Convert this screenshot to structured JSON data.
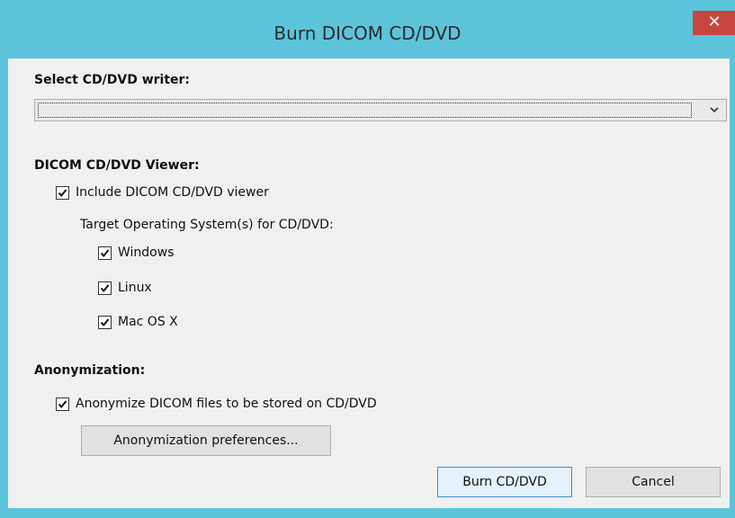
{
  "window": {
    "title": "Burn DICOM CD/DVD",
    "close_label": "✕"
  },
  "writer": {
    "section_label": "Select CD/DVD writer:",
    "selected_value": "",
    "arrow_icon": "chevron-down-icon"
  },
  "viewer": {
    "section_label": "DICOM CD/DVD Viewer:",
    "include_label": "Include DICOM CD/DVD viewer",
    "include_checked": true,
    "target_os_label": "Target Operating System(s) for CD/DVD:",
    "os_options": [
      {
        "label": "Windows",
        "checked": true
      },
      {
        "label": "Linux",
        "checked": true
      },
      {
        "label": "Mac OS X",
        "checked": true
      }
    ]
  },
  "anonymization": {
    "section_label": "Anonymization:",
    "anonymize_label": "Anonymize DICOM files to be stored on CD/DVD",
    "anonymize_checked": true,
    "preferences_button": "Anonymization preferences..."
  },
  "actions": {
    "burn_label": "Burn CD/DVD",
    "cancel_label": "Cancel"
  },
  "colors": {
    "title_bar": "#5bc4db",
    "close_button": "#c7463f",
    "client_bg": "#f0f0f0",
    "default_button_border": "#3c8fd6"
  }
}
